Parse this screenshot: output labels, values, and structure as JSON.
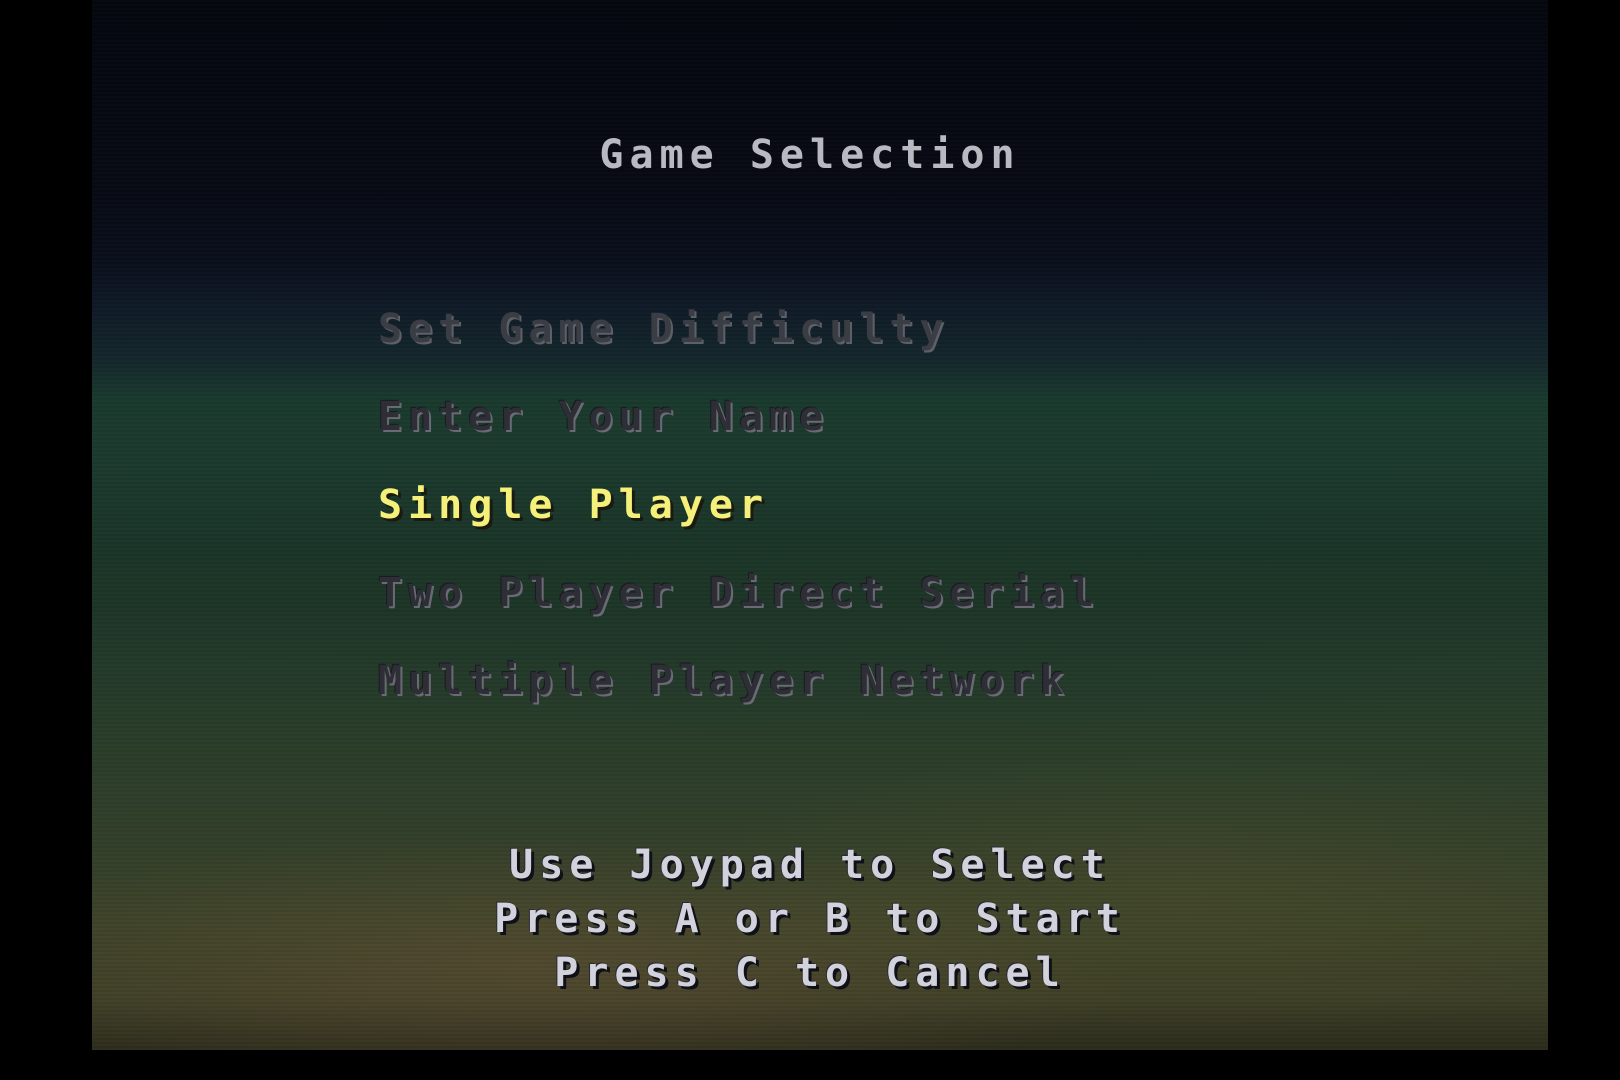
{
  "screen": {
    "title": "Game Selection",
    "menu": [
      {
        "label": "Set Game Difficulty",
        "state": "disabled"
      },
      {
        "label": "Enter Your Name",
        "state": "disabled"
      },
      {
        "label": "Single Player",
        "state": "selected"
      },
      {
        "label": "Two Player Direct Serial",
        "state": "disabled"
      },
      {
        "label": "Multiple Player Network",
        "state": "disabled"
      }
    ],
    "hints": [
      "Use Joypad to Select",
      "Press A or B to Start",
      "Press C to Cancel"
    ],
    "colors": {
      "selected": "#f4f07a",
      "title": "#b9b9c2",
      "hint": "#d2d2dc"
    }
  }
}
